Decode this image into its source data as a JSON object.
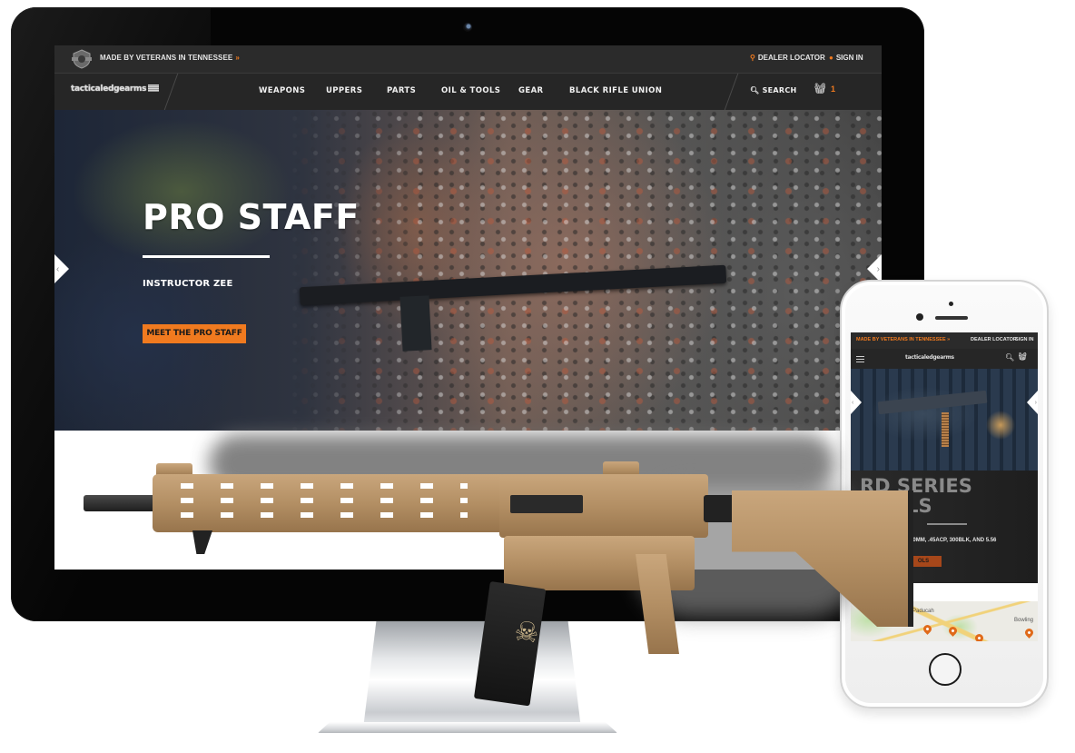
{
  "desktop": {
    "topbar": {
      "tagline": "MADE BY VETERANS IN TENNESSEE",
      "tagline_chevron": "»",
      "dealer_locator": "DEALER LOCATOR",
      "sign_in": "SIGN IN"
    },
    "navbar": {
      "logo_text": "tacticaledgearms",
      "items": [
        {
          "label": "WEAPONS"
        },
        {
          "label": "UPPERS"
        },
        {
          "label": "PARTS"
        },
        {
          "label": "OIL & TOOLS"
        },
        {
          "label": "GEAR"
        },
        {
          "label": "BLACK RIFLE UNION"
        }
      ],
      "search_label": "SEARCH",
      "cart_count": "1"
    },
    "hero": {
      "title": "PRO STAFF",
      "subtitle": "INSTRUCTOR ZEE",
      "cta_label": "MEET THE PRO STAFF",
      "prev_arrow": "‹",
      "next_arrow": "›"
    }
  },
  "mobile": {
    "topbar": {
      "tagline": "MADE BY VETERANS IN TENNESSEE »",
      "dealer_locator": "DEALER LOCATOR",
      "sign_in": "SIGN IN"
    },
    "navbar": {
      "logo_text": "tacticaledgearms"
    },
    "hero": {
      "title": "RD SERIES PISTOLS",
      "title_visible": "RD SERIES\nLS",
      "subtitle": "10MM, .45ACP, 300BLK, AND 5.56",
      "cta_label": "OLS",
      "prev_arrow": "‹",
      "next_arrow": "›"
    },
    "map": {
      "labels": [
        "Paducah",
        "Bowling"
      ]
    }
  },
  "icons": {
    "location": "pin-icon",
    "user": "user-icon",
    "search": "search-icon",
    "cart": "basket-icon",
    "menu": "hamburger-icon"
  },
  "colors": {
    "accent": "#f07a1f",
    "header_bg": "#2b2b2b",
    "nav_bg": "#262626",
    "text_light": "#f2f2f2"
  }
}
